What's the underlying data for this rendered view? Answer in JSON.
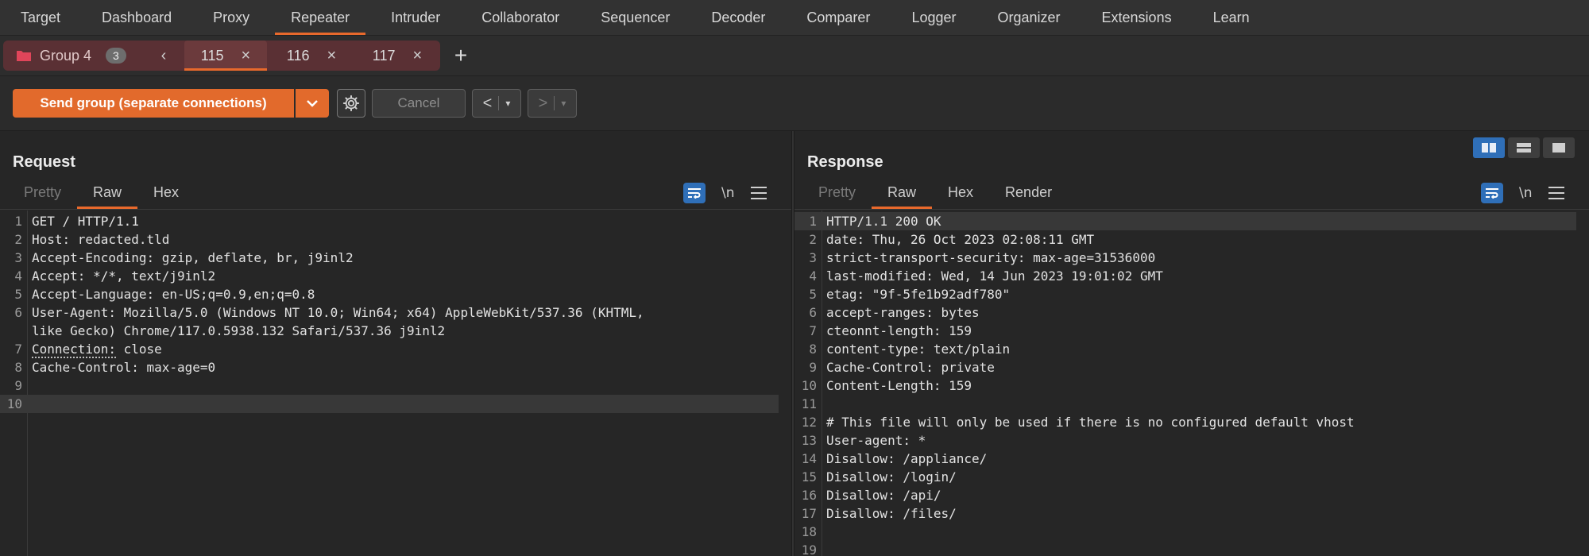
{
  "nav": [
    "Target",
    "Dashboard",
    "Proxy",
    "Repeater",
    "Intruder",
    "Collaborator",
    "Sequencer",
    "Decoder",
    "Comparer",
    "Logger",
    "Organizer",
    "Extensions",
    "Learn"
  ],
  "nav_active": "Repeater",
  "group": {
    "name": "Group 4",
    "count": "3"
  },
  "tabs": [
    {
      "label": "115",
      "close": "×"
    },
    {
      "label": "116",
      "close": "×"
    },
    {
      "label": "117",
      "close": "×"
    }
  ],
  "add_tab": "+",
  "prev_tab": "‹",
  "toolbar": {
    "send_label": "Send group (separate connections)",
    "cancel_label": "Cancel",
    "back_label": "<",
    "forward_label": ">",
    "dropdown": "▾"
  },
  "accent_color": "#e8692c",
  "request": {
    "title": "Request",
    "tabs": [
      "Pretty",
      "Raw",
      "Hex"
    ],
    "active_tab": "Raw",
    "newline_label": "\\n",
    "lines": [
      {
        "n": "1",
        "text": "GET / HTTP/1.1"
      },
      {
        "n": "2",
        "text": "Host: redacted.tld"
      },
      {
        "n": "3",
        "text": "Accept-Encoding: gzip, deflate, br, j9inl2"
      },
      {
        "n": "4",
        "text": "Accept: */*, text/j9inl2"
      },
      {
        "n": "5",
        "text": "Accept-Language: en-US;q=0.9,en;q=0.8"
      },
      {
        "n": "6",
        "text": "User-Agent: Mozilla/5.0 (Windows NT 10.0; Win64; x64) AppleWebKit/537.36 (KHTML,"
      },
      {
        "n": "",
        "text": "like Gecko) Chrome/117.0.5938.132 Safari/537.36 j9inl2"
      },
      {
        "n": "7",
        "text": "close",
        "prefix": "Connection:"
      },
      {
        "n": "8",
        "text": "Cache-Control: max-age=0"
      },
      {
        "n": "9",
        "text": ""
      },
      {
        "n": "10",
        "text": ""
      }
    ]
  },
  "response": {
    "title": "Response",
    "tabs": [
      "Pretty",
      "Raw",
      "Hex",
      "Render"
    ],
    "active_tab": "Raw",
    "newline_label": "\\n",
    "lines": [
      {
        "n": "1",
        "text": "HTTP/1.1 200 OK"
      },
      {
        "n": "2",
        "text": "date: Thu, 26 Oct 2023 02:08:11 GMT"
      },
      {
        "n": "3",
        "text": "strict-transport-security: max-age=31536000"
      },
      {
        "n": "4",
        "text": "last-modified: Wed, 14 Jun 2023 19:01:02 GMT"
      },
      {
        "n": "5",
        "text": "etag: \"9f-5fe1b92adf780\""
      },
      {
        "n": "6",
        "text": "accept-ranges: bytes"
      },
      {
        "n": "7",
        "text": "cteonnt-length: 159"
      },
      {
        "n": "8",
        "text": "content-type: text/plain"
      },
      {
        "n": "9",
        "text": "Cache-Control: private"
      },
      {
        "n": "10",
        "text": "Content-Length: 159"
      },
      {
        "n": "11",
        "text": ""
      },
      {
        "n": "12",
        "text": "# This file will only be used if there is no configured default vhost"
      },
      {
        "n": "13",
        "text": "User-agent: *"
      },
      {
        "n": "14",
        "text": "Disallow: /appliance/"
      },
      {
        "n": "15",
        "text": "Disallow: /login/"
      },
      {
        "n": "16",
        "text": "Disallow: /api/"
      },
      {
        "n": "17",
        "text": "Disallow: /files/"
      },
      {
        "n": "18",
        "text": ""
      },
      {
        "n": "19",
        "text": ""
      }
    ]
  }
}
